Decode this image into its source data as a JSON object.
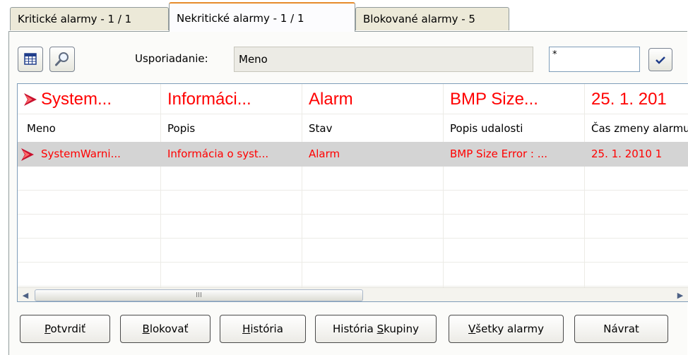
{
  "tabs": [
    {
      "label": "Kritické alarmy - 1 / 1",
      "active": false
    },
    {
      "label": "Nekritické alarmy - 1 / 1",
      "active": true
    },
    {
      "label": "Blokované alarmy - 5",
      "active": false
    }
  ],
  "toolbar": {
    "order_label": "Usporiadanie:",
    "order_value": "Meno",
    "filter_value": "*"
  },
  "table": {
    "highlight": [
      "System...",
      "Informáci...",
      "Alarm",
      "BMP Size...",
      "25. 1. 201"
    ],
    "columns": [
      "Meno",
      "Popis",
      "Stav",
      "Popis udalosti",
      "Čas zmeny alarmu"
    ],
    "rows": [
      [
        "SystemWarni...",
        "Informácia o syst...",
        "Alarm",
        "BMP Size Error : ...",
        "25. 1. 2010 1"
      ]
    ],
    "scroll_grip": "III"
  },
  "buttons": [
    {
      "pre": "",
      "key": "P",
      "post": "otvrdiť"
    },
    {
      "pre": "",
      "key": "B",
      "post": "lokovať"
    },
    {
      "pre": "",
      "key": "H",
      "post": "istória"
    },
    {
      "pre": "História ",
      "key": "S",
      "post": "kupiny"
    },
    {
      "pre": "",
      "key": "V",
      "post": "šetky alarmy"
    },
    {
      "pre": "Návrat",
      "key": "",
      "post": ""
    }
  ],
  "colors": {
    "alarm_text": "#ff0000",
    "selected_row": "#d4d4d4",
    "active_tab_accent": "#e68b2c"
  },
  "icons": [
    "grid-view-icon",
    "magnifier-icon",
    "checkmark-icon",
    "alarm-flag-icon",
    "scroll-left-icon",
    "scroll-right-icon"
  ]
}
